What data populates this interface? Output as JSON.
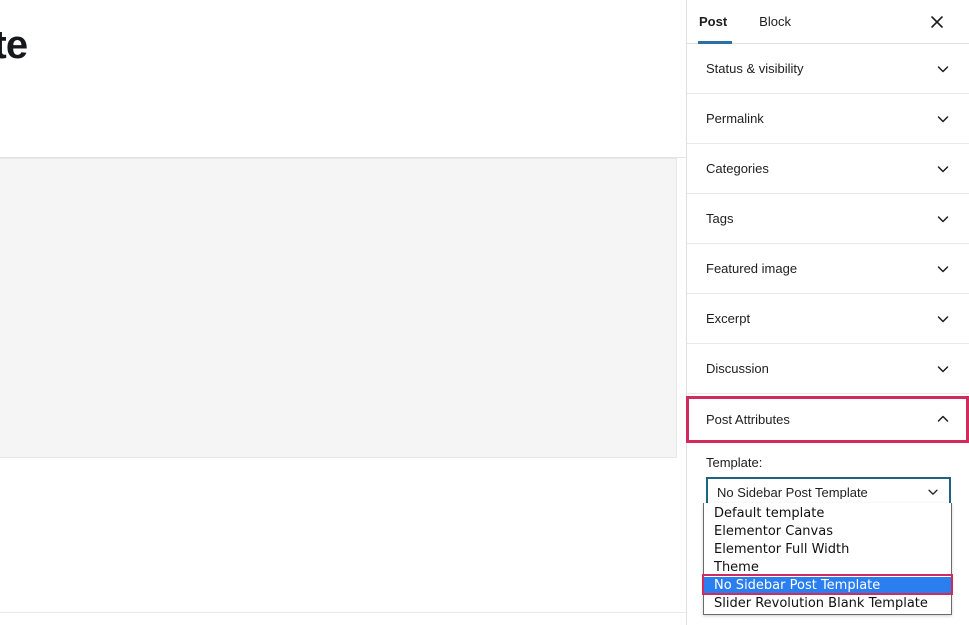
{
  "editor": {
    "post_title_visible_fragment": "plete",
    "content_block_placeholder": ""
  },
  "sidebar": {
    "tabs": [
      {
        "label": "Post",
        "active": true
      },
      {
        "label": "Block",
        "active": false
      }
    ],
    "close_label": "Close settings",
    "close_icon": "close-icon",
    "sections": [
      {
        "label": "Status & visibility",
        "state": "collapsed",
        "icon": "chevron-down-icon"
      },
      {
        "label": "Permalink",
        "state": "collapsed",
        "icon": "chevron-down-icon"
      },
      {
        "label": "Categories",
        "state": "collapsed",
        "icon": "chevron-down-icon"
      },
      {
        "label": "Tags",
        "state": "collapsed",
        "icon": "chevron-down-icon"
      },
      {
        "label": "Featured image",
        "state": "collapsed",
        "icon": "chevron-down-icon"
      },
      {
        "label": "Excerpt",
        "state": "collapsed",
        "icon": "chevron-down-icon"
      },
      {
        "label": "Discussion",
        "state": "collapsed",
        "icon": "chevron-down-icon"
      },
      {
        "label": "Post Attributes",
        "state": "expanded",
        "icon": "chevron-up-icon"
      }
    ],
    "post_attributes": {
      "template_label": "Template:",
      "template_selected": "No Sidebar Post Template",
      "template_options": [
        "Default template",
        "Elementor Canvas",
        "Elementor Full Width",
        "Theme",
        "No Sidebar Post Template",
        "Slider Revolution Blank Template"
      ],
      "selected_index": 4,
      "caret_icon": "chevron-down-icon"
    }
  },
  "colors": {
    "accent_tab_underline": "#2a70a8",
    "highlight_ring": "#d32a5e",
    "select_border": "#1d6480",
    "option_selected_bg": "#2a7ef0",
    "panel_border": "#e0e0e0",
    "content_block_bg": "#f5f5f5"
  }
}
